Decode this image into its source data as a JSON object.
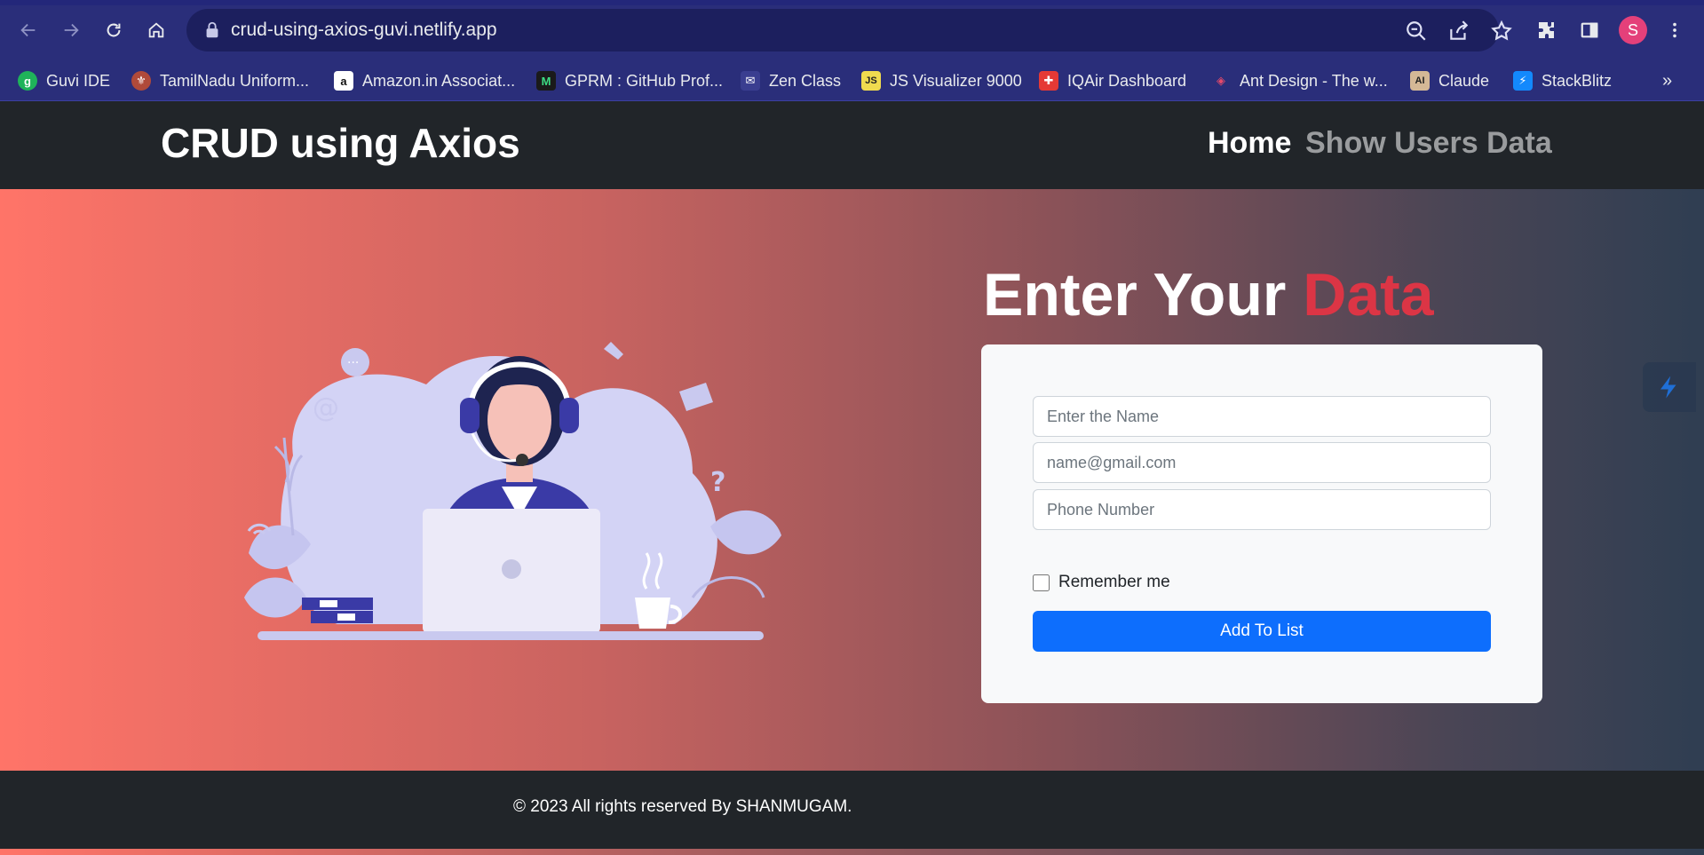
{
  "browser": {
    "url": "crud-using-axios-guvi.netlify.app",
    "profile_initial": "S",
    "bookmarks": [
      {
        "label": "Guvi IDE",
        "icon": "guvi-icon",
        "color": "#1fb35a"
      },
      {
        "label": "TamilNadu Uniform...",
        "icon": "emblem-icon",
        "color": "#b04a3a"
      },
      {
        "label": "Amazon.in Associat...",
        "icon": "amazon-icon",
        "color": "#ffffff"
      },
      {
        "label": "GPRM : GitHub Prof...",
        "icon": "gprm-icon",
        "color": "#1a1a1a"
      },
      {
        "label": "Zen Class",
        "icon": "mail-icon",
        "color": "#3a3e90"
      },
      {
        "label": "JS Visualizer 9000",
        "icon": "js-icon",
        "color": "#f0db4f"
      },
      {
        "label": "IQAir Dashboard",
        "icon": "iqair-icon",
        "color": "#e53935"
      },
      {
        "label": "Ant Design - The w...",
        "icon": "antdesign-icon",
        "color": "#2a2e7a"
      },
      {
        "label": "Claude",
        "icon": "claude-icon",
        "color": "#d4b896"
      },
      {
        "label": "StackBlitz",
        "icon": "stackblitz-icon",
        "color": "#1389fd"
      }
    ],
    "more_label": "»"
  },
  "navbar": {
    "brand": "CRUD using Axios",
    "links": [
      "Home",
      "Show Users Data"
    ]
  },
  "hero": {
    "headline_main": "Enter Your",
    "headline_accent": "Data",
    "form": {
      "name_placeholder": "Enter the Name",
      "email_placeholder": "name@gmail.com",
      "phone_placeholder": "Phone Number",
      "remember_label": "Remember me",
      "submit_label": "Add To List"
    }
  },
  "footer": {
    "text": "© 2023 All rights reserved By SHANMUGAM."
  },
  "colors": {
    "accent": "#dc3545",
    "primary_button": "#0d6efd",
    "navbar": "#212529",
    "browser_chrome": "#2a2e7a"
  }
}
